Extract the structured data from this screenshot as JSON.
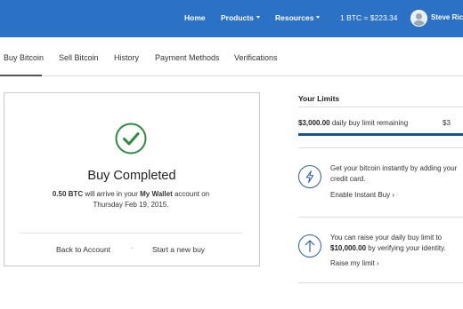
{
  "nav": {
    "home": "Home",
    "products": "Products",
    "resources": "Resources",
    "price": "1 BTC = $223.34",
    "user_name": "Steve Rich"
  },
  "tabs": [
    "Buy Bitcoin",
    "Sell Bitcoin",
    "History",
    "Payment Methods",
    "Verifications"
  ],
  "active_tab": "Buy Bitcoin",
  "completed": {
    "title": "Buy Completed",
    "amount": "0.50 BTC",
    "text_1": "will arrive in your",
    "wallet": "My Wallet",
    "text_2": "account on",
    "date": "Thursday Feb 19, 2015.",
    "back_link": "Back to Account",
    "separator": "·",
    "new_buy_link": "Start a new buy"
  },
  "limits": {
    "title": "Your Limits",
    "amount": "$3,000.00",
    "remaining_text": "daily buy limit remaining",
    "right_value": "$3",
    "instant": {
      "text": "Get your bitcoin instantly by adding your credit card.",
      "link": "Enable Instant Buy ›"
    },
    "raise": {
      "text_1": "You can raise your daily buy limit to",
      "amount": "$10,000.00",
      "text_2": "by verifying your identity.",
      "link": "Raise my limit ›"
    }
  },
  "colors": {
    "nav_bg": "#2b71c6",
    "success_green": "#2e8b3e",
    "limit_bar": "#1a4f9c",
    "icon_blue": "#2b5faa"
  },
  "icons": [
    "user-avatar-icon",
    "check-circle-icon",
    "lightning-icon",
    "arrow-up-icon"
  ]
}
